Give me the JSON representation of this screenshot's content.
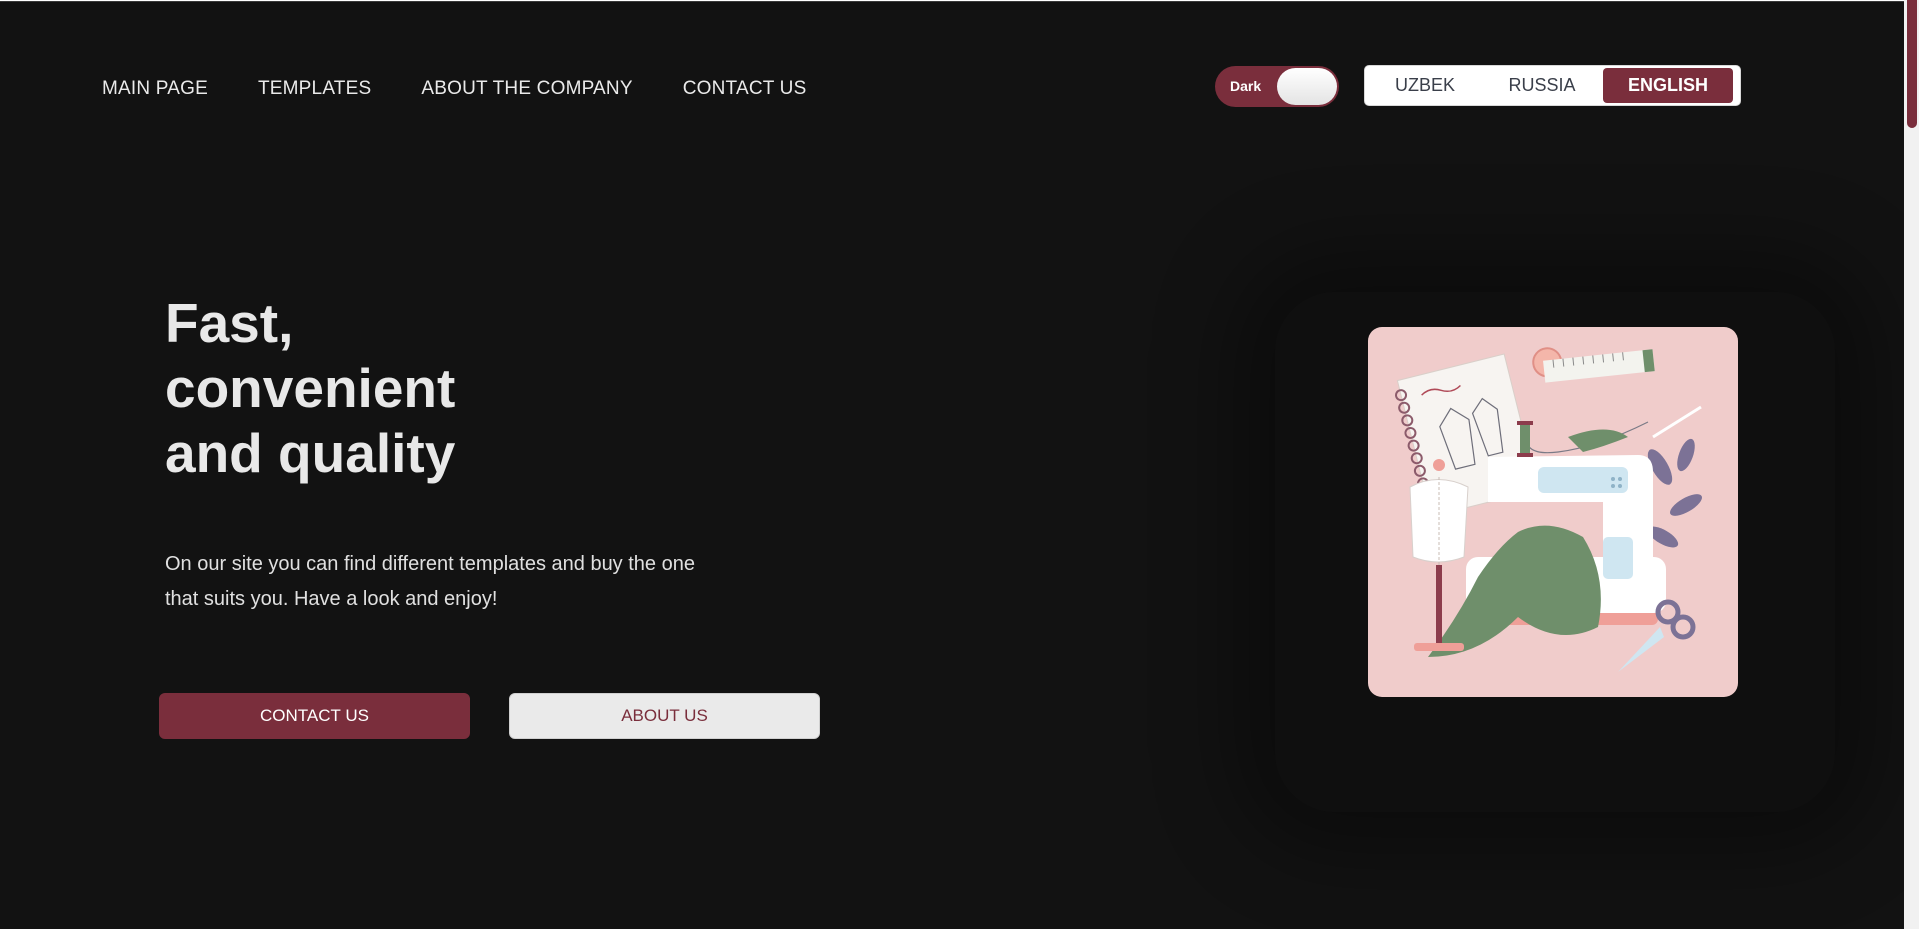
{
  "nav": {
    "items": [
      "MAIN PAGE",
      "TEMPLATES",
      "ABOUT THE COMPANY",
      "CONTACT US"
    ]
  },
  "theme_toggle": {
    "label": "Dark",
    "on": true
  },
  "language": {
    "options": [
      "UZBEK",
      "RUSSIA",
      "ENGLISH"
    ],
    "selected": "ENGLISH"
  },
  "hero": {
    "title_lines": [
      "Fast,",
      "convenient",
      "and quality"
    ],
    "description": "On our site you can find different templates and buy the one that suits you. Have a look and enjoy!",
    "primary_button": "CONTACT US",
    "secondary_button": "ABOUT US"
  },
  "illustration": {
    "subject": "sewing machine with mannequin, fabric, measuring tape, sketchbook and scissors"
  },
  "colors": {
    "background": "#121212",
    "accent": "#7a2e3c",
    "text": "#e8e8e8",
    "illustration_bg": "#f0cccb"
  }
}
